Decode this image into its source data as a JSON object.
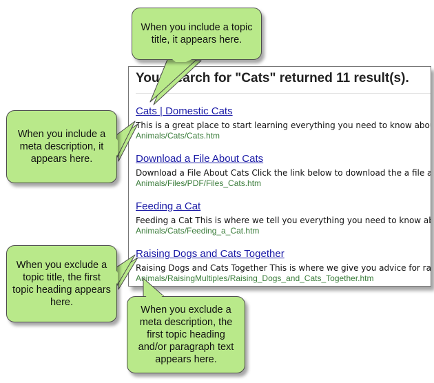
{
  "search": {
    "heading": "Your search for \"Cats\" returned 11 result(s)."
  },
  "results": [
    {
      "title": "Cats | Domestic Cats",
      "desc": "This is a great place to start learning everything you need to know about C",
      "url": "Animals/Cats/Cats.htm"
    },
    {
      "title": "Download a File About Cats",
      "desc": "Download a File About Cats Click the link below to download the a file abo",
      "url": "Animals/Files/PDF/Files_Cats.htm"
    },
    {
      "title": "Feeding a Cat",
      "desc": "Feeding a Cat This is where we tell you everything you need to know about",
      "url": "Animals/Cats/Feeding_a_Cat.htm"
    },
    {
      "title": "Raising Dogs and Cats Together",
      "desc": "Raising Dogs and Cats Together This is where we give you advice for raisin",
      "url": "Animals/RaisingMultiples/Raising_Dogs_and_Cats_Together.htm"
    }
  ],
  "callouts": {
    "topic_title": "When you include a topic title, it appears here.",
    "meta_description": "When you include a meta description, it appears here.",
    "exclude_title": "When you exclude a topic title, the first topic heading appears here.",
    "exclude_description": "When you exclude a meta description, the first topic heading and/or paragraph text appears here."
  },
  "colors": {
    "callout_fill": "#b9e98a",
    "link": "#1a1aa6",
    "url": "#3a7c3a"
  }
}
